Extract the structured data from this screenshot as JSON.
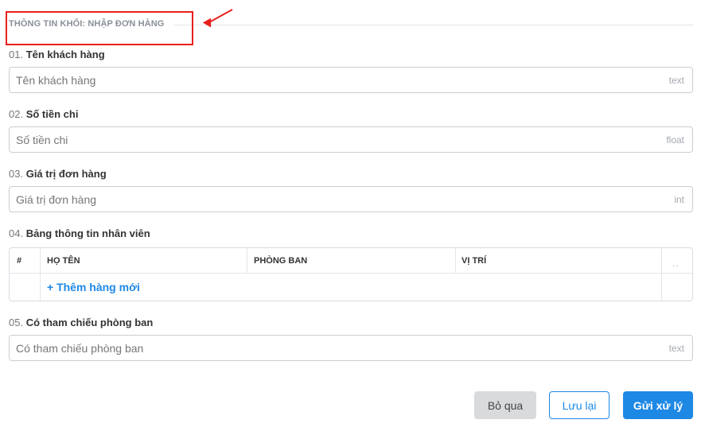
{
  "section": {
    "title": "THÔNG TIN KHỐI: NHẬP ĐƠN HÀNG"
  },
  "fields": [
    {
      "num": "01.",
      "label": "Tên khách hàng",
      "placeholder": "Tên khách hàng",
      "type_hint": "text"
    },
    {
      "num": "02.",
      "label": "Số tiền chi",
      "placeholder": "Số tiền chi",
      "type_hint": "float"
    },
    {
      "num": "03.",
      "label": "Giá trị đơn hàng",
      "placeholder": "Giá trị đơn hàng",
      "type_hint": "int"
    },
    {
      "num": "04.",
      "label": "Bảng thông tin nhân viên"
    },
    {
      "num": "05.",
      "label": "Có tham chiếu phòng ban",
      "placeholder": "Có tham chiếu phòng ban",
      "type_hint": "text"
    }
  ],
  "table": {
    "columns": [
      "#",
      "HỌ TÊN",
      "PHÒNG BAN",
      "VỊ TRÍ"
    ],
    "add_row_label": "+ Thêm hàng mới",
    "more_icon": "··"
  },
  "buttons": {
    "skip": "Bỏ qua",
    "save": "Lưu lại",
    "submit": "Gửi xử lý"
  },
  "colors": {
    "accent": "#1e88e5",
    "highlight": "#e8201c"
  }
}
